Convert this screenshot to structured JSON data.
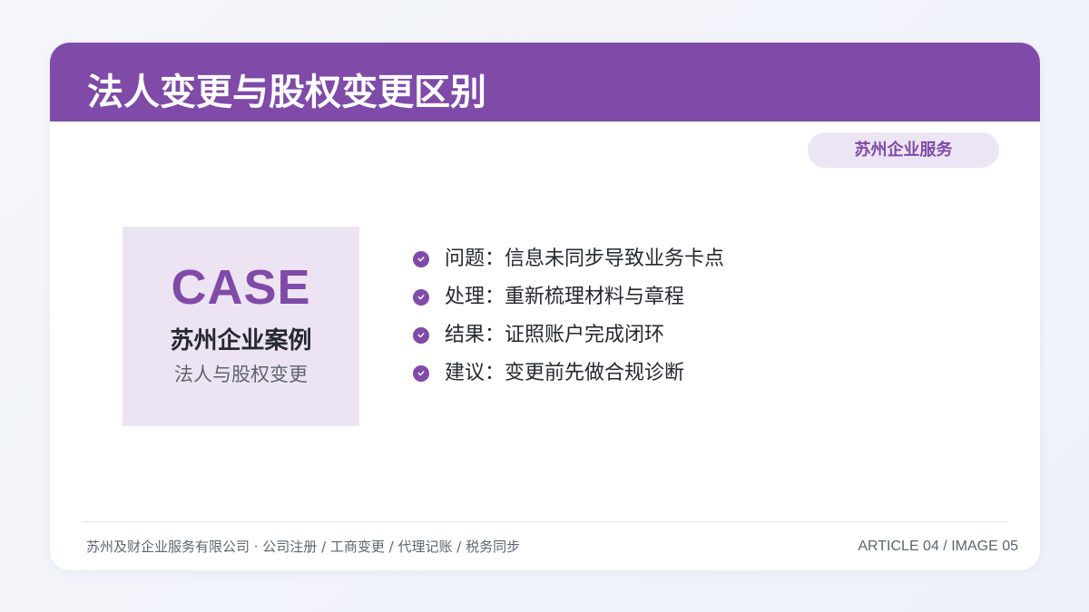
{
  "header": {
    "title": "法人变更与股权变更区别",
    "color": "#7f4aa8"
  },
  "badge": {
    "label": "苏州企业服务"
  },
  "case": {
    "word": "CASE",
    "title": "苏州企业案例",
    "subtitle": "法人与股权变更"
  },
  "bullets": [
    {
      "icon": "check-circle-icon",
      "text": "问题：信息未同步导致业务卡点"
    },
    {
      "icon": "check-circle-icon",
      "text": "处理：重新梳理材料与章程"
    },
    {
      "icon": "check-circle-icon",
      "text": "结果：证照账户完成闭环"
    },
    {
      "icon": "check-circle-icon",
      "text": "建议：变更前先做合规诊断"
    }
  ],
  "footer": {
    "left": "苏州及财企业服务有限公司 · 公司注册 / 工商变更 / 代理记账 / 税务同步",
    "right": "ARTICLE 04 / IMAGE 05"
  },
  "colors": {
    "accent": "#7f4aa8",
    "accent_light": "#ede4f3",
    "text_dark": "#252830",
    "text_muted": "#5e6470"
  }
}
